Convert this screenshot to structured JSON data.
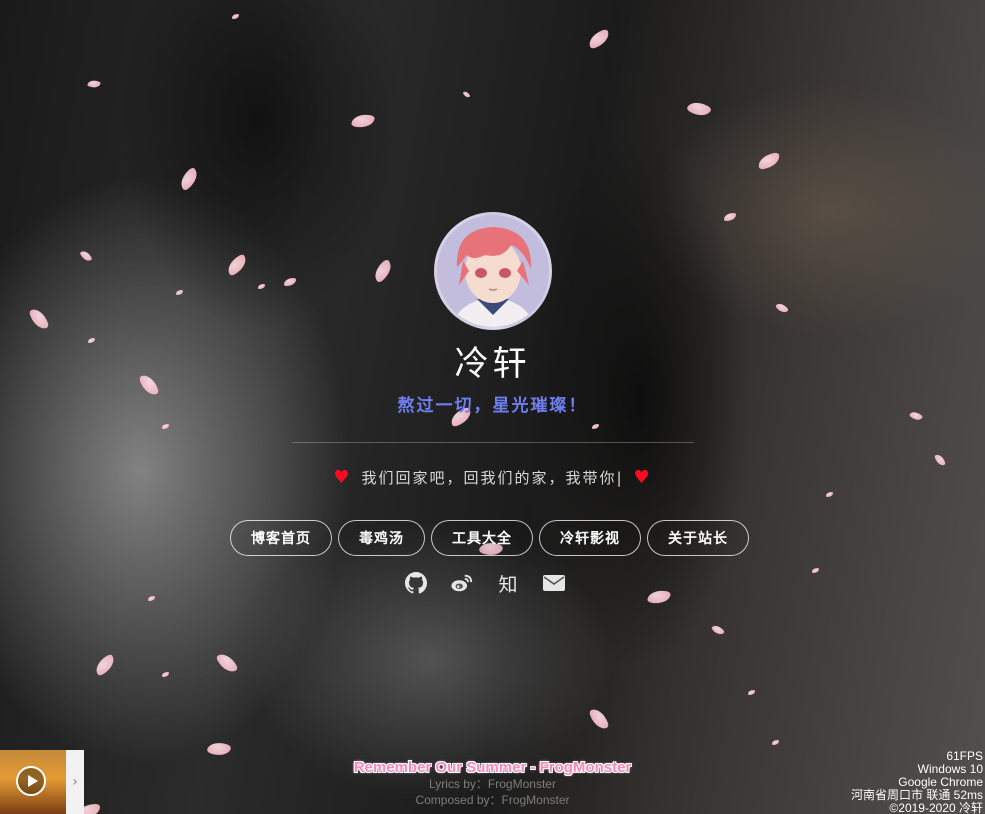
{
  "profile": {
    "name": "冷轩",
    "motto": "熬过一切，星光璀璨！",
    "typing_text": "我们回家吧，回我们的家，我带你|"
  },
  "nav": [
    {
      "label": "博客首页"
    },
    {
      "label": "毒鸡汤"
    },
    {
      "label": "工具大全"
    },
    {
      "label": "冷轩影视"
    },
    {
      "label": "关于站长"
    }
  ],
  "social": {
    "zhihu_label": "知"
  },
  "music": {
    "title": "Remember Our Summer - FrogMonster",
    "lyrics_by": "Lyrics by：FrogMonster",
    "composed_by": "Composed by：FrogMonster"
  },
  "status": {
    "fps": "61FPS",
    "os": "Windows 10",
    "browser": "Google Chrome",
    "location": "河南省周口市 联通 52ms",
    "copyright": "©2019-2020 冷轩"
  },
  "icons": {
    "heart": "heart-icon",
    "github": "github-icon",
    "weibo": "weibo-icon",
    "zhihu": "zhihu-icon",
    "mail": "mail-icon",
    "play": "play-icon",
    "chevron": "chevron-right-icon"
  },
  "colors": {
    "motto": "#6f7ff0",
    "heart": "#ff0a22",
    "song_title": "#ff86b7",
    "petal": "#f6a9bb"
  }
}
